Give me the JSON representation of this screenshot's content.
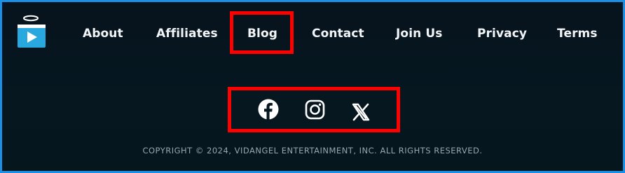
{
  "brand": {
    "name": "VidAngel",
    "logo_icon": "vidangel-play-halo-icon",
    "accent": "#29a8e0"
  },
  "nav": {
    "items": [
      {
        "label": "About"
      },
      {
        "label": "Affiliates"
      },
      {
        "label": "Blog"
      },
      {
        "label": "Contact"
      },
      {
        "label": "Join Us"
      },
      {
        "label": "Privacy"
      },
      {
        "label": "Terms"
      }
    ],
    "highlighted": "Blog"
  },
  "social": {
    "icons": [
      "facebook-icon",
      "instagram-icon",
      "x-icon"
    ],
    "highlighted": true
  },
  "footer": {
    "copyright": "COPYRIGHT © 2024, VIDANGEL ENTERTAINMENT, INC. ALL RIGHTS RESERVED."
  },
  "colors": {
    "background": "#061720",
    "frame": "#1a8fe6",
    "highlight": "#ff0000",
    "text": "#f2f5f7"
  }
}
